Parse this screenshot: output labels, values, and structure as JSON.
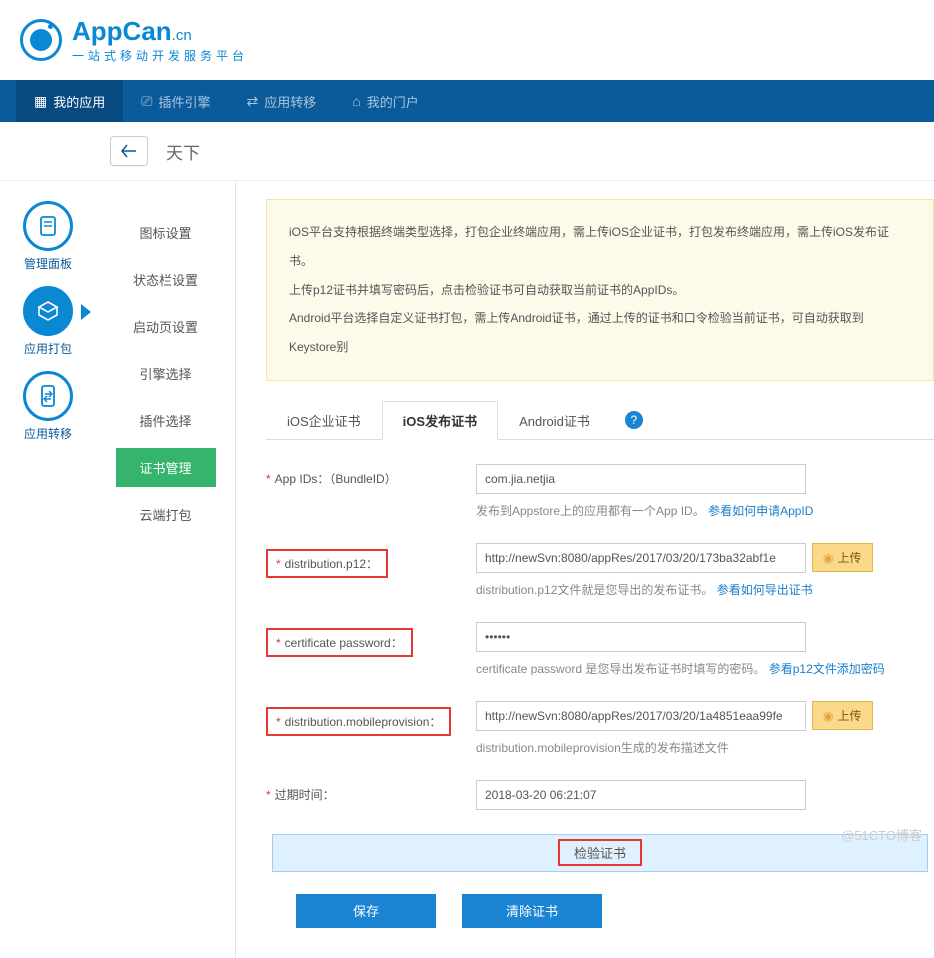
{
  "logo": {
    "name": "AppCan",
    "suffix": ".cn",
    "slogan": "一站式移动开发服务平台"
  },
  "topnav": [
    {
      "label": "我的应用",
      "active": true
    },
    {
      "label": "插件引擎"
    },
    {
      "label": "应用转移"
    },
    {
      "label": "我的门户"
    }
  ],
  "appbar": {
    "title": "天下"
  },
  "leftnodes": [
    {
      "label": "管理面板"
    },
    {
      "label": "应用打包",
      "active": true
    },
    {
      "label": "应用转移"
    }
  ],
  "submenu": [
    {
      "label": "图标设置"
    },
    {
      "label": "状态栏设置"
    },
    {
      "label": "启动页设置"
    },
    {
      "label": "引擎选择"
    },
    {
      "label": "插件选择"
    },
    {
      "label": "证书管理",
      "active": true
    },
    {
      "label": "云端打包"
    }
  ],
  "notice": {
    "line1": "iOS平台支持根据终端类型选择，打包企业终端应用，需上传iOS企业证书，打包发布终端应用，需上传iOS发布证书。",
    "line2": "上传p12证书并填写密码后，点击检验证书可自动获取当前证书的AppIDs。",
    "line3": "Android平台选择自定义证书打包，需上传Android证书，通过上传的证书和口令检验当前证书，可自动获取到Keystore别"
  },
  "tabs": {
    "t1": "iOS企业证书",
    "t2": "iOS发布证书",
    "t3": "Android证书"
  },
  "form": {
    "appid_label": "App IDs：（BundleID）",
    "appid_value": "com.jia.netjia",
    "appid_hint": "发布到Appstore上的应用都有一个App ID。",
    "appid_link": "参看如何申请AppID",
    "p12_label": "distribution.p12：",
    "p12_value": "http://newSvn:8080/appRes/2017/03/20/173ba32abf1e",
    "p12_hint": "distribution.p12文件就是您导出的发布证书。",
    "p12_link": "参看如何导出证书",
    "pwd_label": "certificate password：",
    "pwd_value": "••••••",
    "pwd_hint": "certificate password 是您导出发布证书时填写的密码。",
    "pwd_link": "参看p12文件添加密码",
    "prov_label": "distribution.mobileprovision：",
    "prov_value": "http://newSvn:8080/appRes/2017/03/20/1a4851eaa99fe",
    "prov_hint": "distribution.mobileprovision生成的发布描述文件",
    "exp_label": "过期时间：",
    "exp_value": "2018-03-20 06:21:07",
    "upload": "上传",
    "verify": "检验证书",
    "save": "保存",
    "clear": "清除证书"
  },
  "watermark": "@51CTO博客"
}
